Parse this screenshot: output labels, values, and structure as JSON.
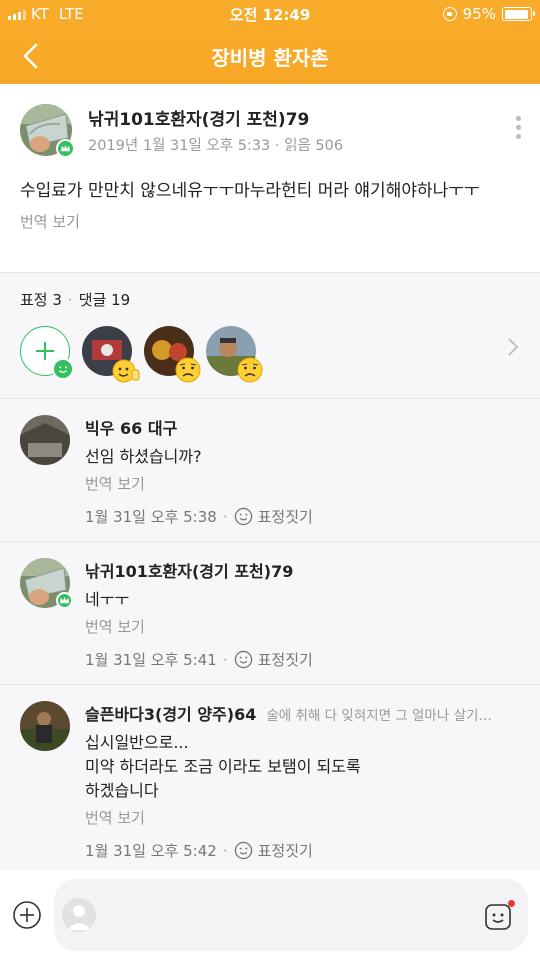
{
  "status_bar": {
    "carrier": "KT",
    "network": "LTE",
    "time": "오전 12:49",
    "battery": "95%",
    "battery_level": 0.95
  },
  "header": {
    "title": "장비병 환자촌"
  },
  "post": {
    "author": "낚귀101호환자(경기 포천)79",
    "meta": "2019년 1월 31일 오후 5:33 · 읽음 506",
    "body": "수입료가 만만치 않으네유ㅜㅜ마누라헌티 머라 얘기해야하나ㅜㅜ",
    "translate": "번역 보기"
  },
  "counts": {
    "reactions": "표정 3",
    "comments": "댓글 19"
  },
  "reaction_users": [
    {
      "emoji": "thumbs-up-emoji"
    },
    {
      "emoji": "sad-emoji"
    },
    {
      "emoji": "sad-emoji"
    }
  ],
  "comments": [
    {
      "author": "빅우 66 대구",
      "tag": "",
      "text": "선임 하셨습니까?",
      "translate": "번역 보기",
      "time": "1월 31일 오후 5:38",
      "react_label": "표정짓기"
    },
    {
      "author": "낚귀101호환자(경기 포천)79",
      "tag": "",
      "text": "네ㅜㅜ",
      "translate": "번역 보기",
      "time": "1월 31일 오후 5:41",
      "react_label": "표정짓기"
    },
    {
      "author": "슬픈바다3(경기 양주)64",
      "tag": "술에 취해 다 잊혀지면 그 얼마나 살기…",
      "text_lines": [
        "십시일반으로...",
        "미약 하더라도 조금 이라도 보탬이 되도록",
        "하겠습니다"
      ],
      "translate": "번역 보기",
      "time": "1월 31일 오후 5:42",
      "react_label": "표정짓기"
    }
  ],
  "colors": {
    "header": "#f7a726",
    "accent_green": "#33c05e"
  }
}
